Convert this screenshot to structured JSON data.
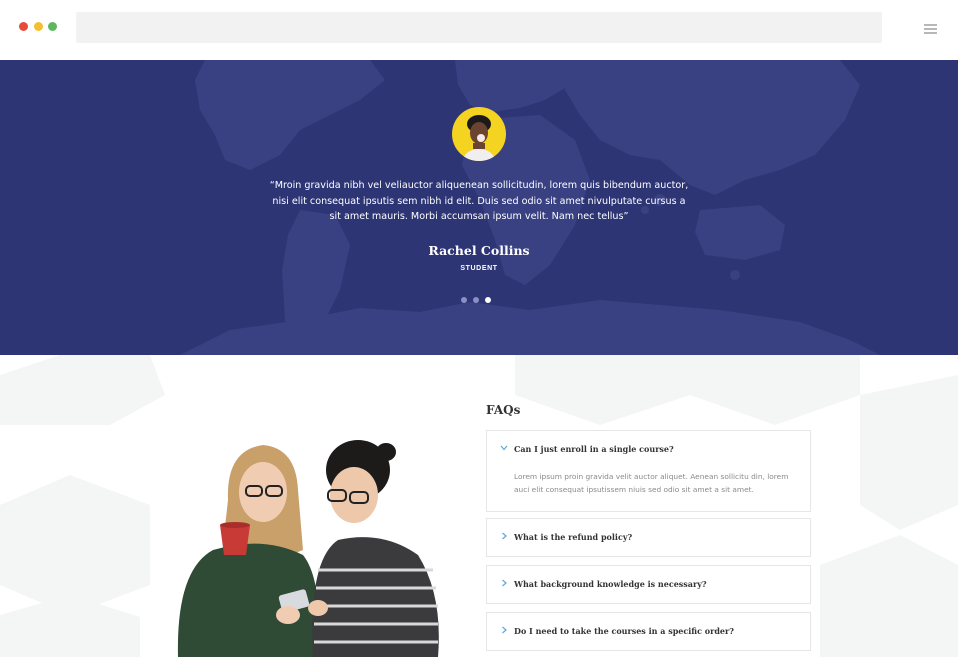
{
  "colors": {
    "window_red": "#e64c3c",
    "window_yellow": "#f2c12e",
    "window_green": "#5cb85c",
    "hero_bg": "#2e3575",
    "hero_map": "#3b4284",
    "avatar_bg": "#f4d321",
    "chevron": "#5aa9d6"
  },
  "browser": {
    "menu_icon": "hamburger-icon"
  },
  "testimonial": {
    "quote": "“Mroin gravida nibh vel veliauctor aliquenean sollicitudin, lorem quis bibendum auctor, nisi elit consequat ipsutis sem nibh id elit. Duis sed odio sit amet nivulputate cursus a sit amet mauris. Morbi accumsan ipsum velit. Nam nec tellus”",
    "name": "Rachel Collins",
    "role": "STUDENT",
    "slides": 3,
    "active_slide": 3
  },
  "faq": {
    "title": "FAQs",
    "items": [
      {
        "question": "Can I just enroll in a single course?",
        "answer": "Lorem ipsum proin gravida velit auctor aliquet. Aenean sollicitu din, lorem auci elit consequat ipsutissem niuis sed odio sit amet a sit amet.",
        "expanded": true
      },
      {
        "question": "What is the refund policy?",
        "expanded": false
      },
      {
        "question": "What background knowledge is necessary?",
        "expanded": false
      },
      {
        "question": "Do I need to take the courses in a specific order?",
        "expanded": false
      }
    ]
  }
}
